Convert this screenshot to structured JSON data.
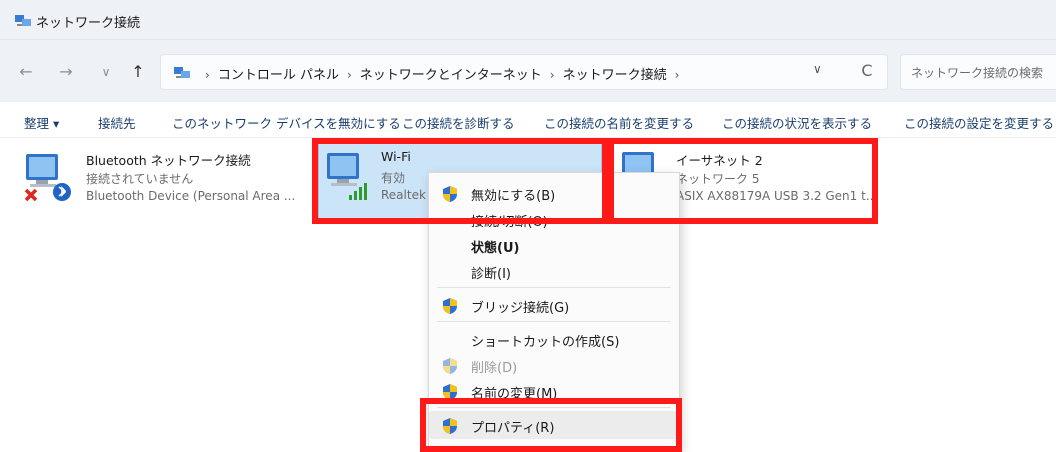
{
  "window": {
    "title": "ネットワーク接続"
  },
  "nav": {
    "back": "←",
    "forward": "→",
    "recent": "∨",
    "up": "↑"
  },
  "address": {
    "crumbs": [
      "コントロール パネル",
      "ネットワークとインターネット",
      "ネットワーク接続"
    ],
    "separator": "›",
    "dropdown": "∨",
    "refresh": "C"
  },
  "search": {
    "placeholder": "ネットワーク接続の検索"
  },
  "toolbar": {
    "organize": "整理 ▾",
    "connect_to": "接続先",
    "disable_device": "このネットワーク デバイスを無効にする",
    "diagnose": "この接続を診断する",
    "rename": "この接続の名前を変更する",
    "view_status": "この接続の状況を表示する",
    "change_settings": "この接続の設定を変更する"
  },
  "connections": [
    {
      "name": "Bluetooth ネットワーク接続",
      "status": "接続されていません",
      "device": "Bluetooth Device (Personal Area ..."
    },
    {
      "name": "Wi-Fi",
      "status": "有効",
      "device": "Realtek"
    },
    {
      "name": "イーサネット 2",
      "status": "ネットワーク 5",
      "device": "ASIX AX88179A USB 3.2 Gen1 t..."
    }
  ],
  "context_menu": {
    "disable": "無効にする(B)",
    "connect": "接続/切断(O)",
    "status": "状態(U)",
    "diagnose": "診断(I)",
    "bridge": "ブリッジ接続(G)",
    "shortcut": "ショートカットの作成(S)",
    "delete": "削除(D)",
    "rename": "名前の変更(M)",
    "properties": "プロパティ(R)"
  },
  "colors": {
    "highlight": "#ff1a1a",
    "selected": "#cce4f7",
    "shield_blue": "#2f6fd1",
    "shield_yellow": "#f3c21a"
  }
}
